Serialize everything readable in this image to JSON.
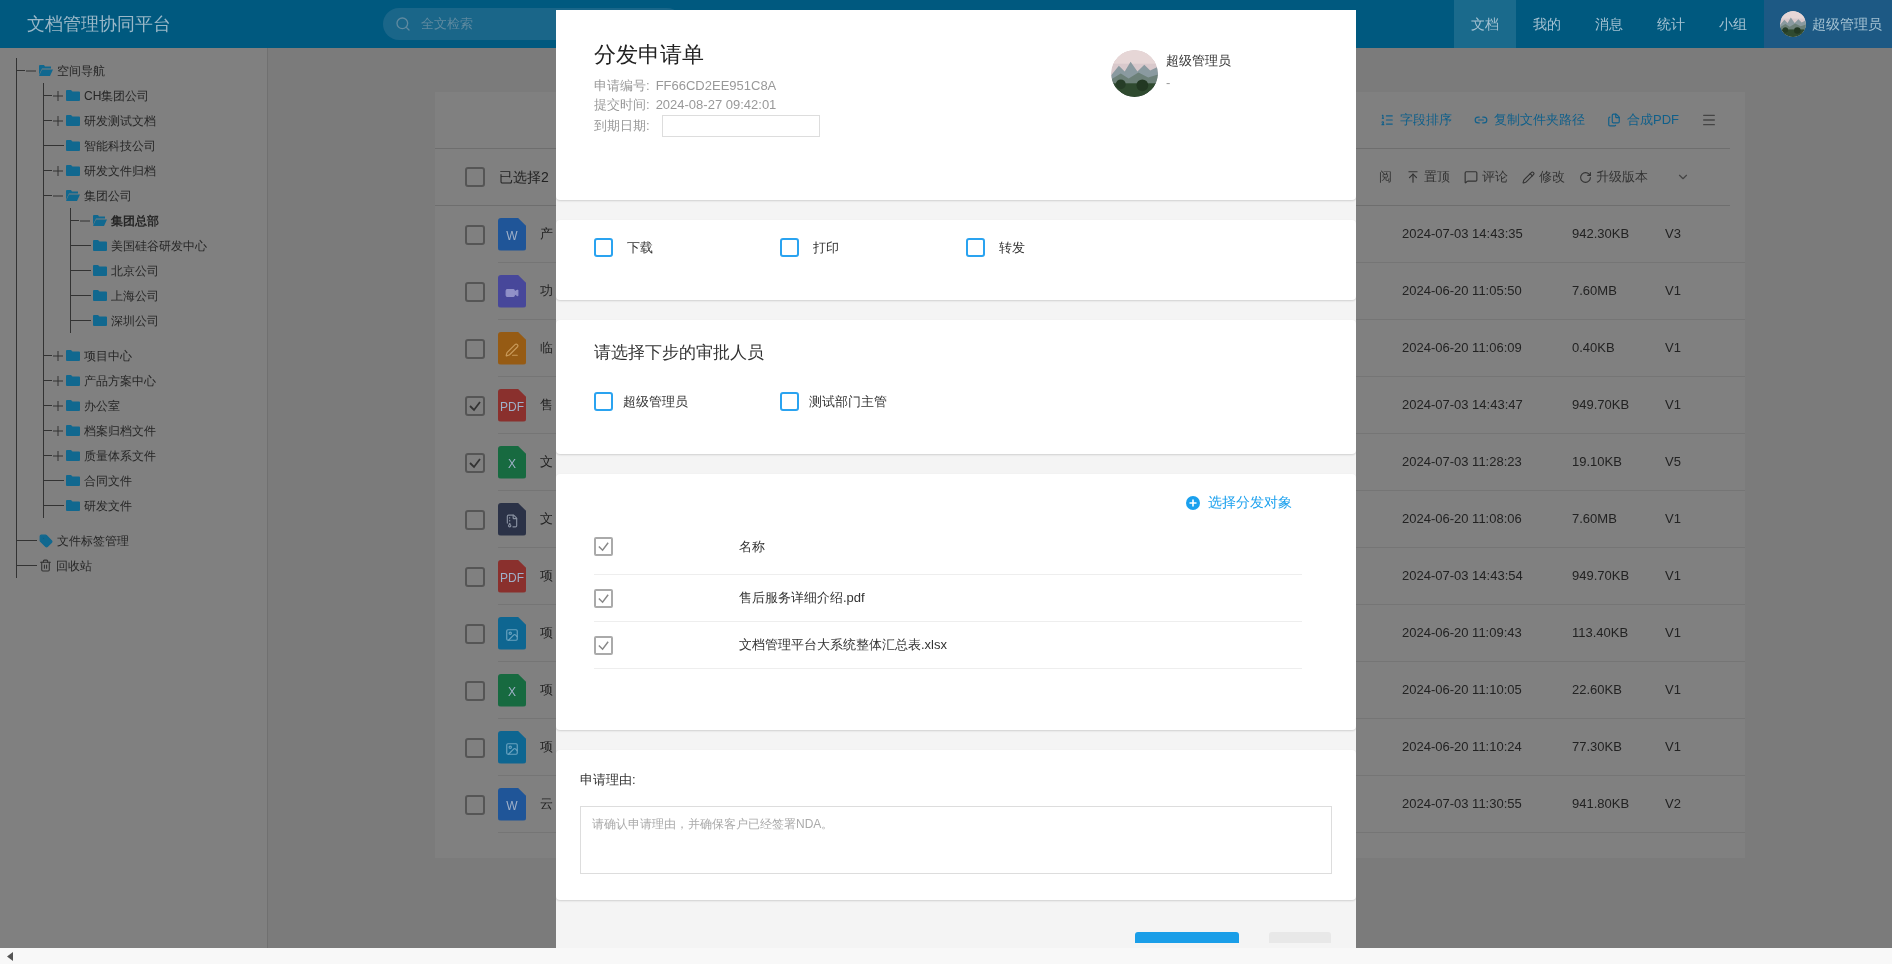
{
  "header": {
    "title": "文档管理协同平台",
    "search": {
      "placeholder": "全文检索"
    },
    "nav": [
      {
        "label": "文档",
        "selected": true
      },
      {
        "label": "我的",
        "selected": false
      },
      {
        "label": "消息",
        "selected": false
      },
      {
        "label": "统计",
        "selected": false
      },
      {
        "label": "小组",
        "selected": false
      }
    ],
    "user": {
      "name": "超级管理员"
    }
  },
  "sidebar": {
    "tree": [
      {
        "label": "空间导航",
        "kind": "folder",
        "expanded": true,
        "selected": false,
        "children": [
          {
            "label": "CH集团公司",
            "kind": "folder",
            "expanded": false,
            "selected": false
          },
          {
            "label": "研发测试文档",
            "kind": "folder",
            "expanded": false,
            "selected": false
          },
          {
            "label": "智能科技公司",
            "kind": "folder",
            "selected": false
          },
          {
            "label": "研发文件归档",
            "kind": "folder",
            "expanded": false,
            "selected": false
          },
          {
            "label": "集团公司",
            "kind": "folder",
            "expanded": true,
            "selected": false,
            "children": [
              {
                "label": "集团总部",
                "kind": "folder",
                "expanded": true,
                "selected": true
              },
              {
                "label": "美国硅谷研发中心",
                "kind": "folder",
                "selected": false
              },
              {
                "label": "北京公司",
                "kind": "folder",
                "selected": false
              },
              {
                "label": "上海公司",
                "kind": "folder",
                "selected": false
              },
              {
                "label": "深圳公司",
                "kind": "folder",
                "selected": false
              }
            ]
          },
          {
            "label": "项目中心",
            "kind": "folder",
            "expanded": false,
            "selected": false
          },
          {
            "label": "产品方案中心",
            "kind": "folder",
            "expanded": false,
            "selected": false
          },
          {
            "label": "办公室",
            "kind": "folder",
            "expanded": false,
            "selected": false
          },
          {
            "label": "档案归档文件",
            "kind": "folder",
            "expanded": false,
            "selected": false
          },
          {
            "label": "质量体系文件",
            "kind": "folder",
            "expanded": false,
            "selected": false
          },
          {
            "label": "合同文件",
            "kind": "folder",
            "selected": false
          },
          {
            "label": "研发文件",
            "kind": "folder",
            "selected": false
          }
        ]
      },
      {
        "label": "文件标签管理",
        "kind": "tag",
        "selected": false
      },
      {
        "label": "回收站",
        "kind": "trash",
        "selected": false
      }
    ]
  },
  "files": {
    "toolbar": [
      {
        "label": "字段排序",
        "kind": "sort"
      },
      {
        "label": "复制文件夹路径",
        "kind": "link"
      },
      {
        "label": "合成PDF",
        "kind": "pdf"
      }
    ],
    "header": {
      "checked": false,
      "label": "已选择2"
    },
    "actions": [
      {
        "label": "阅",
        "kind": "none"
      },
      {
        "label": "置顶",
        "kind": "top"
      },
      {
        "label": "评论",
        "kind": "comment"
      },
      {
        "label": "修改",
        "kind": "edit"
      },
      {
        "label": "升级版本",
        "kind": "upgrade"
      }
    ],
    "rows": [
      {
        "checked": false,
        "kind": "word",
        "icon_label": "W",
        "name": "产",
        "modified": "2024-07-03 14:43:35",
        "size": "942.30KB",
        "version": "V3"
      },
      {
        "checked": false,
        "kind": "video",
        "name": "功",
        "modified": "2024-06-20 11:05:50",
        "size": "7.60MB",
        "version": "V1"
      },
      {
        "checked": false,
        "kind": "edit",
        "name": "临",
        "modified": "2024-06-20 11:06:09",
        "size": "0.40KB",
        "version": "V1"
      },
      {
        "checked": true,
        "kind": "pdf",
        "icon_label": "PDF",
        "name": "售",
        "modified": "2024-07-03 14:43:47",
        "size": "949.70KB",
        "version": "V1"
      },
      {
        "checked": true,
        "kind": "excel",
        "icon_label": "X",
        "name": "文",
        "modified": "2024-07-03 11:28:23",
        "size": "19.10KB",
        "version": "V5"
      },
      {
        "checked": false,
        "kind": "zip",
        "name": "文",
        "modified": "2024-06-20 11:08:06",
        "size": "7.60MB",
        "version": "V1"
      },
      {
        "checked": false,
        "kind": "pdf",
        "icon_label": "PDF",
        "name": "项",
        "modified": "2024-07-03 14:43:54",
        "size": "949.70KB",
        "version": "V1"
      },
      {
        "checked": false,
        "name": "项",
        "modified": "2024-06-20 11:09:43",
        "size": "113.40KB",
        "version": "V1"
      },
      {
        "checked": false,
        "kind": "excel",
        "icon_label": "X",
        "name": "项",
        "modified": "2024-06-20 11:10:05",
        "size": "22.60KB",
        "version": "V1"
      },
      {
        "checked": false,
        "name": "项",
        "modified": "2024-06-20 11:10:24",
        "size": "77.30KB",
        "version": "V1"
      },
      {
        "checked": false,
        "kind": "word",
        "icon_label": "W",
        "name": "云",
        "modified": "2024-07-03 11:30:55",
        "size": "941.80KB",
        "version": "V2"
      }
    ]
  },
  "dialog": {
    "title": "分发申请单",
    "fields": [
      {
        "label": "申请编号:",
        "value": "FF66CD2EE951C8A"
      },
      {
        "label": "提交时间:",
        "value": "2024-08-27 09:42:01"
      }
    ],
    "due_date": {
      "label": "到期日期:"
    },
    "applicant": {
      "name": "超级管理员",
      "detail": "-"
    },
    "permissions": [
      {
        "label": "下载",
        "checked": false
      },
      {
        "label": "打印",
        "checked": false
      },
      {
        "label": "转发",
        "checked": false
      }
    ],
    "approvers": {
      "heading": "请选择下步的审批人员",
      "options": [
        {
          "label": "超级管理员",
          "checked": false
        },
        {
          "label": "测试部门主管",
          "checked": false
        }
      ]
    },
    "targets": {
      "add_link": "选择分发对象",
      "header": {
        "label": "名称",
        "checked": true
      },
      "rows": [
        {
          "name": "售后服务详细介绍.pdf",
          "checked": true
        },
        {
          "name": "文档管理平台大系统整体汇总表.xlsx",
          "checked": true
        }
      ]
    },
    "reason": {
      "label": "申请理由:",
      "placeholder": "请确认申请理由，并确保客户已经签署NDA。"
    }
  }
}
